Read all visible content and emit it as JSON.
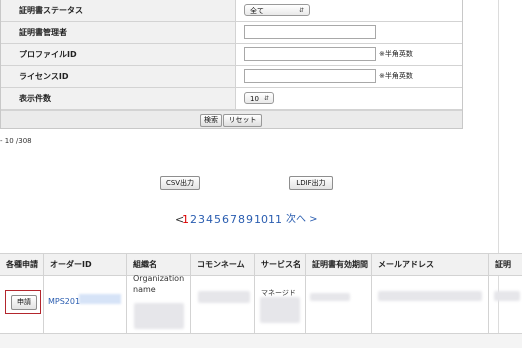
{
  "search_form": {
    "rows": [
      {
        "label": "証明書ステータス",
        "type": "select",
        "value": "全て"
      },
      {
        "label": "証明書管理者",
        "type": "text",
        "value": ""
      },
      {
        "label": "プロファイルID",
        "type": "text",
        "value": "",
        "hint": "※半角英数"
      },
      {
        "label": "ライセンスID",
        "type": "text",
        "value": "",
        "hint": "※半角英数"
      },
      {
        "label": "表示件数",
        "type": "select",
        "value": "10"
      }
    ],
    "search_button": "検索",
    "reset_button": "リセット"
  },
  "result_count": "- 10 /308",
  "export": {
    "csv_button": "CSV出力",
    "ldif_button": "LDIF出力"
  },
  "pagination": {
    "prev": "<",
    "pages": [
      "1",
      "2",
      "3",
      "4",
      "5",
      "6",
      "7",
      "8",
      "9",
      "10",
      "11"
    ],
    "current": "1",
    "next": "次へ >"
  },
  "table": {
    "headers": [
      "各種申請",
      "オーダーID",
      "組織名",
      "コモンネーム",
      "サービス名",
      "証明書有効期間",
      "メールアドレス",
      "証明"
    ],
    "rows": [
      {
        "apply_button": "申請",
        "order_id": "MPS201",
        "organization": "Organization name",
        "service": "マネージド"
      }
    ]
  }
}
